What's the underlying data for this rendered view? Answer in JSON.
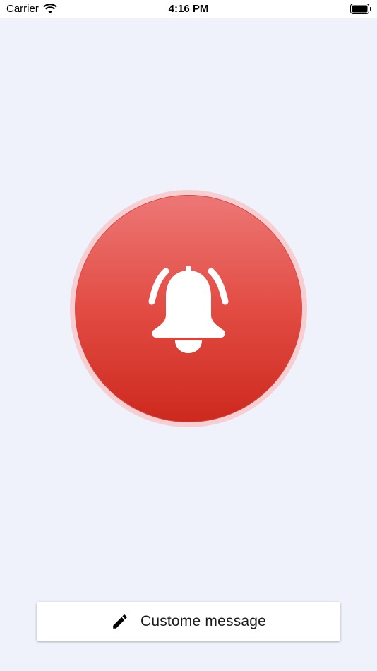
{
  "status_bar": {
    "carrier": "Carrier",
    "time": "4:16 PM",
    "wifi_icon": "wifi-icon",
    "battery_icon": "battery-full-icon"
  },
  "alarm": {
    "icon": "bell-ringing-icon",
    "outer_ring_color": "#f7cfd3",
    "gradient_top": "#ed7776",
    "gradient_bottom": "#cd291e"
  },
  "message_button": {
    "icon": "pencil-icon",
    "label": "Custome message"
  }
}
